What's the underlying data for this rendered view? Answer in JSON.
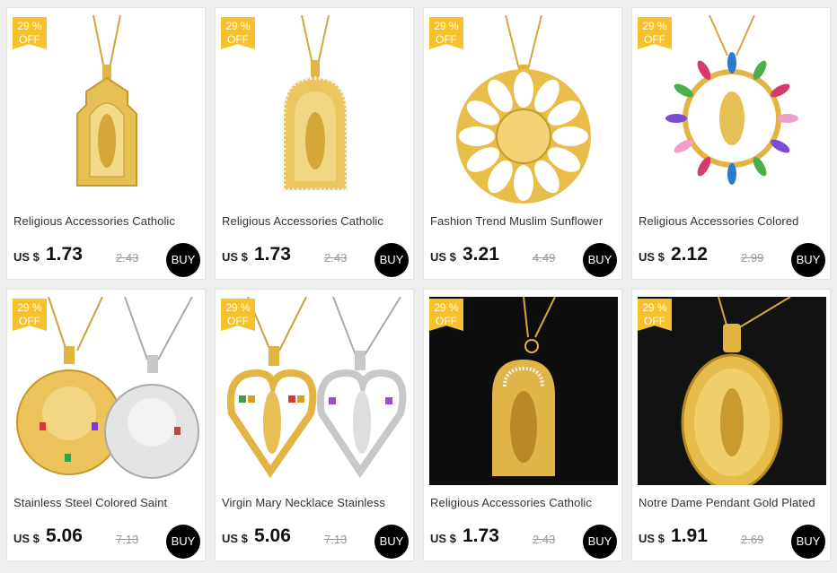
{
  "products": [
    {
      "badge_pct": "29 %",
      "badge_off": "OFF",
      "title": "Religious Accessories Catholic",
      "currency": "US $",
      "price": "1.73",
      "old_price": "2.43",
      "buy_label": "BUY"
    },
    {
      "badge_pct": "29 %",
      "badge_off": "OFF",
      "title": "Religious Accessories Catholic",
      "currency": "US $",
      "price": "1.73",
      "old_price": "2.43",
      "buy_label": "BUY"
    },
    {
      "badge_pct": "29 %",
      "badge_off": "OFF",
      "title": "Fashion Trend Muslim Sunflower",
      "currency": "US $",
      "price": "3.21",
      "old_price": "4.49",
      "buy_label": "BUY"
    },
    {
      "badge_pct": "29 %",
      "badge_off": "OFF",
      "title": "Religious Accessories Colored",
      "currency": "US $",
      "price": "2.12",
      "old_price": "2.99",
      "buy_label": "BUY"
    },
    {
      "badge_pct": "29 %",
      "badge_off": "OFF",
      "title": "Stainless Steel Colored Saint",
      "currency": "US $",
      "price": "5.06",
      "old_price": "7.13",
      "buy_label": "BUY"
    },
    {
      "badge_pct": "29 %",
      "badge_off": "OFF",
      "title": "Virgin Mary Necklace Stainless",
      "currency": "US $",
      "price": "5.06",
      "old_price": "7.13",
      "buy_label": "BUY"
    },
    {
      "badge_pct": "29 %",
      "badge_off": "OFF",
      "title": "Religious Accessories Catholic",
      "currency": "US $",
      "price": "1.73",
      "old_price": "2.43",
      "buy_label": "BUY"
    },
    {
      "badge_pct": "29 %",
      "badge_off": "OFF",
      "title": "Notre Dame Pendant Gold Plated",
      "currency": "US $",
      "price": "1.91",
      "old_price": "2.69",
      "buy_label": "BUY"
    }
  ],
  "colors": {
    "badge": "#f6c12b",
    "gold": "#e2b441",
    "buy": "#000000"
  }
}
